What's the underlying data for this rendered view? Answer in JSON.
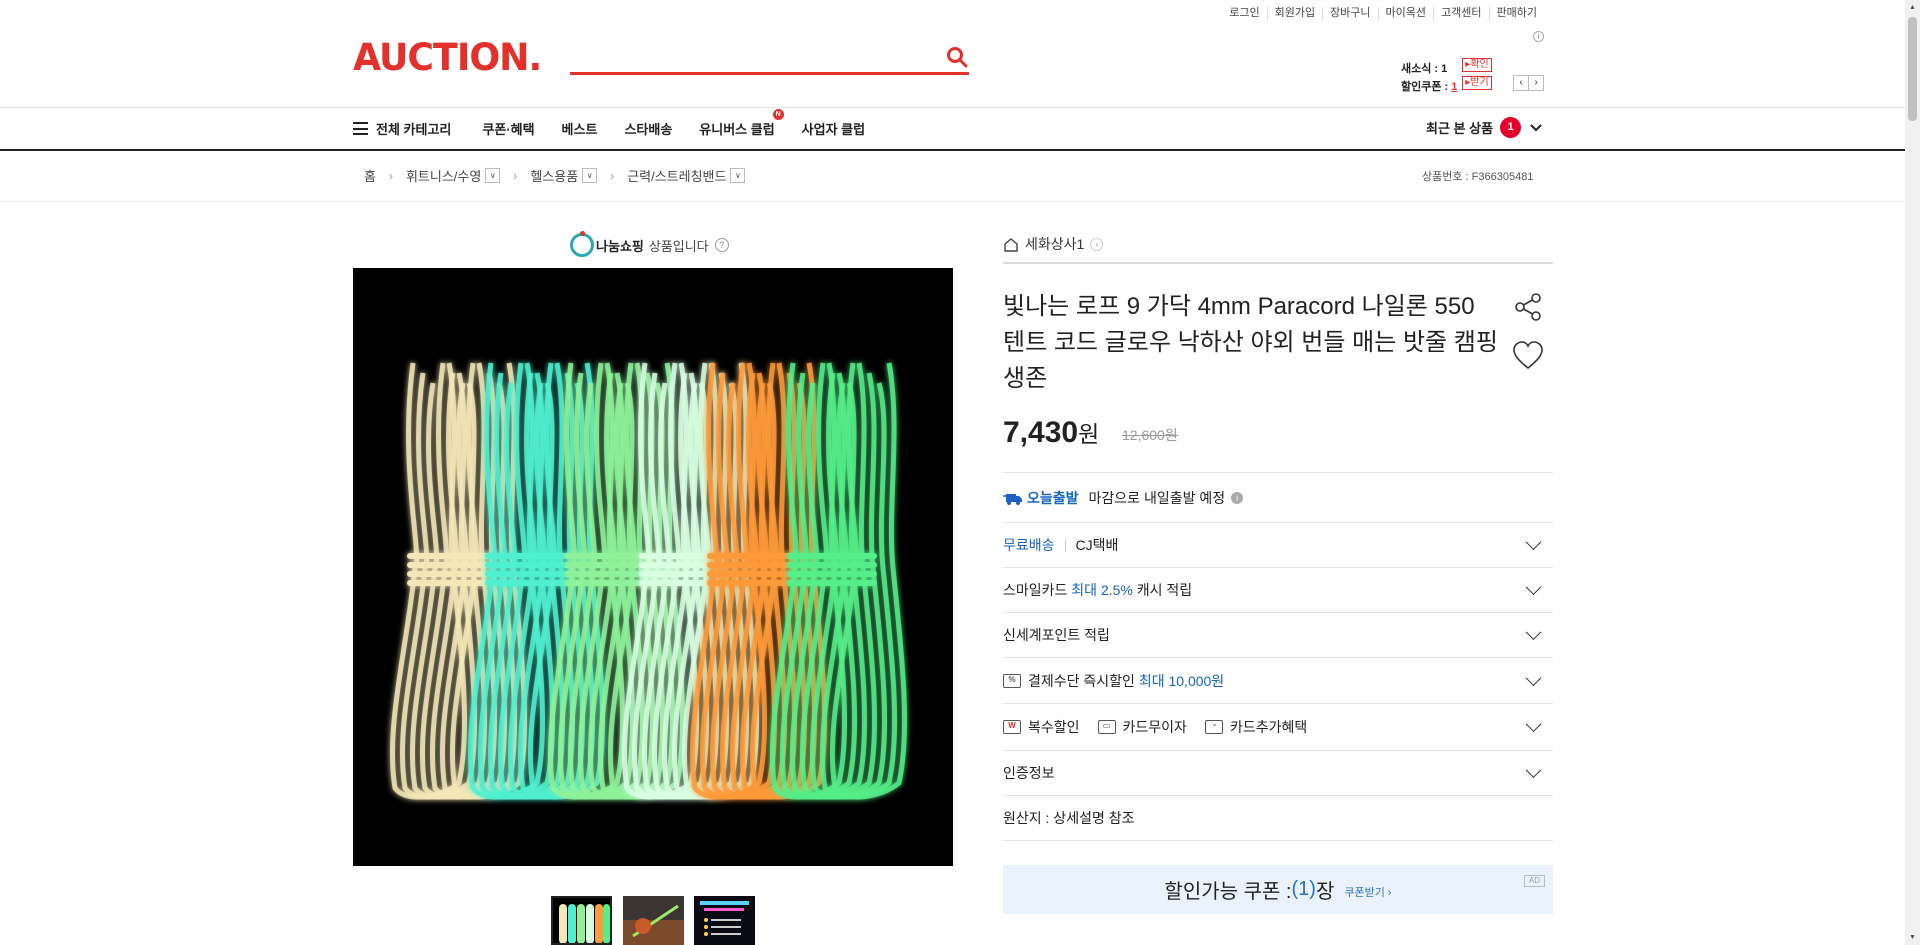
{
  "top_links": [
    "로그인",
    "회원가입",
    "장바구니",
    "마이옥션",
    "고객센터",
    "판매하기"
  ],
  "logo_text": "AUCTION.",
  "search": {
    "placeholder": ""
  },
  "mini_cart": {
    "alert_label": "새소식 : 1",
    "alert_button": "확인",
    "coupon_label": "할인쿠폰 : ",
    "coupon_count": "1",
    "coupon_button": "받기"
  },
  "nav": {
    "all_category": "전체 카테고리",
    "items": [
      "쿠폰·혜택",
      "베스트",
      "스타배송",
      "유니버스 클럽",
      "사업자 클럽"
    ],
    "new_badge": "N",
    "recent_label": "최근 본 상품",
    "recent_count": "1"
  },
  "breadcrumb": {
    "home": "홈",
    "levels": [
      "휘트니스/수영",
      "헬스용품",
      "근력/스트레칭밴드"
    ]
  },
  "product_number": "상품번호 : F366305481",
  "nanum": {
    "brand": "나눔쇼핑",
    "text": "상품입니다"
  },
  "store_name": "세화상사1",
  "product_title": "빛나는 로프 9 가닥 4mm Paracord 나일론 550 텐트 코드 글로우 낙하산 야외 번들 매는 밧줄 캠핑 생존",
  "price": {
    "amount": "7,430",
    "currency": "원",
    "original": "12,600원"
  },
  "shipping": {
    "today_label": "오늘출발",
    "today_text": "마감으로 내일출발 예정",
    "free_label": "무료배송",
    "courier": "CJ택배"
  },
  "benefits": {
    "smile_prefix": "스마일카드",
    "smile_highlight": "최대 2.5%",
    "smile_suffix": "캐시 적립",
    "shinsegae": "신세계포인트 적립",
    "payment_prefix": "결제수단 즉시할인",
    "payment_highlight": "최대 10,000원",
    "multi_discount": "복수할인",
    "card_interest": "카드무이자",
    "card_extra": "카드추가혜택",
    "certification": "인증정보",
    "origin": "원산지 : 상세설명 참조"
  },
  "coupon": {
    "prefix": "할인가능 쿠폰 : ",
    "count": "(1)",
    "suffix": "장",
    "get": "쿠폰받기 ›",
    "ad": "AD"
  },
  "rope_colors": [
    "#f3e7b8",
    "#4ff0d0",
    "#8ef29a",
    "#d8ffe2",
    "#ff9a3a",
    "#55ee88"
  ]
}
